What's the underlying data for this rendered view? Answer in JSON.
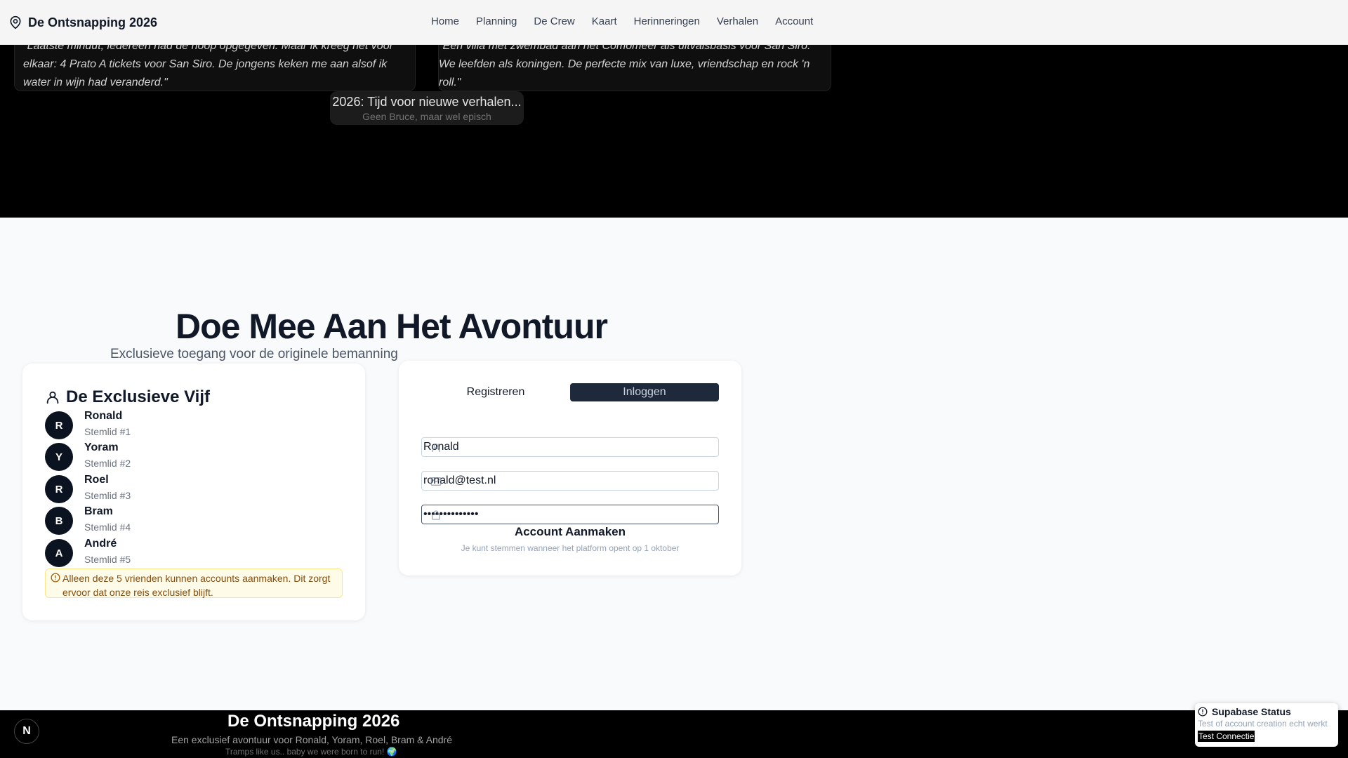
{
  "header": {
    "brand": "De Ontsnapping 2026",
    "nav": [
      "Home",
      "Planning",
      "De Crew",
      "Kaart",
      "Herinneringen",
      "Verhalen",
      "Account"
    ]
  },
  "stories": {
    "left_quote": "\"Laatste minuut, iedereen had de hoop opgegeven. Maar ik kreeg het voor elkaar: 4 Prato A tickets voor San Siro. De jongens keken me aan alsof ik water in wijn had veranderd.\"",
    "right_quote": "\"Een villa met zwembad aan het Comomeer als uitvalsbasis voor San Siro. We leefden als koningen. De perfecte mix van luxe, vriendschap en rock 'n roll.\"",
    "more_title": "2026: Tijd voor nieuwe verhalen...",
    "more_subtitle": "Geen Bruce, maar wel episch"
  },
  "join": {
    "title": "Doe Mee Aan Het Avontuur",
    "subtitle": "Exclusieve toegang voor de originele bemanning"
  },
  "crew": {
    "title": "De Exclusieve Vijf",
    "members": [
      {
        "initial": "R",
        "name": "Ronald",
        "role": "Stemlid #1"
      },
      {
        "initial": "Y",
        "name": "Yoram",
        "role": "Stemlid #2"
      },
      {
        "initial": "R",
        "name": "Roel",
        "role": "Stemlid #3"
      },
      {
        "initial": "B",
        "name": "Bram",
        "role": "Stemlid #4"
      },
      {
        "initial": "A",
        "name": "André",
        "role": "Stemlid #5"
      }
    ],
    "notice": "Alleen deze 5 vrienden kunnen accounts aanmaken. Dit zorgt ervoor dat onze reis exclusief blijft."
  },
  "form": {
    "tabs": [
      "Registreren",
      "Inloggen"
    ],
    "active_tab": "Inloggen",
    "name_value": "Ronald",
    "email_value": "ronald@test.nl",
    "password_value": "••••••••••••••",
    "submit_label": "Account Aanmaken",
    "hint": "Je kunt stemmen wanneer het platform opent op 1 oktober"
  },
  "footer": {
    "badge": "N",
    "title": "De Ontsnapping 2026",
    "subtitle": "Een exclusief avontuur voor Ronald, Yoram, Roel, Bram & André",
    "tagline": "Tramps like us.. baby we were born to run! 🌍"
  },
  "status": {
    "title": "Supabase Status",
    "description": "Test of account creation echt werkt",
    "button": "Test Connectie"
  }
}
